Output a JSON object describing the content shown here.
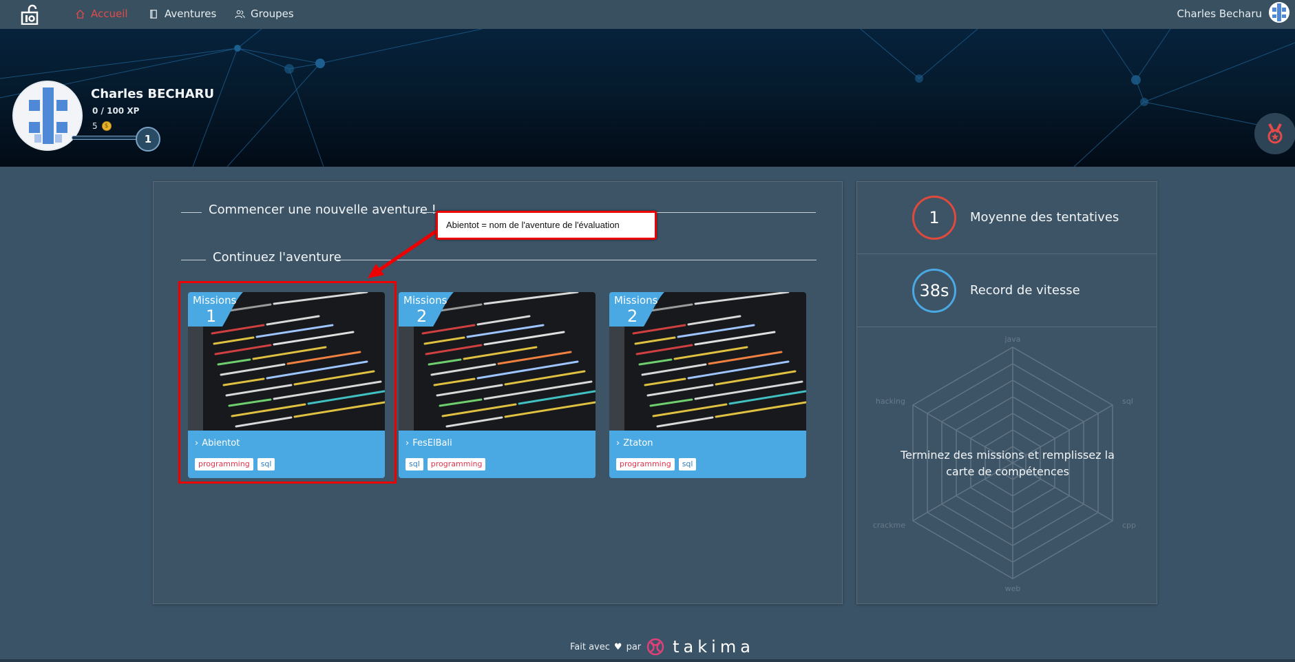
{
  "nav": {
    "logo": "lock-logo-icon",
    "items": [
      {
        "label": "Accueil",
        "icon": "home-icon",
        "active": true
      },
      {
        "label": "Aventures",
        "icon": "book-icon",
        "active": false
      },
      {
        "label": "Groupes",
        "icon": "users-icon",
        "active": false
      }
    ],
    "user_name": "Charles Becharu"
  },
  "profile": {
    "name": "Charles BECHARU",
    "xp": "0 / 100 XP",
    "coins": "5",
    "coin_symbol": "$",
    "level": "1",
    "xp_progress": 0
  },
  "main": {
    "new_adventure_title": "Commencer une nouvelle aventure !",
    "continue_title": "Continuez l'aventure",
    "cards": [
      {
        "missions_label": "Missions",
        "missions_count": "1",
        "title": "Abientot",
        "tags": [
          "programming",
          "sql"
        ]
      },
      {
        "missions_label": "Missions",
        "missions_count": "2",
        "title": "FesElBali",
        "tags": [
          "sql",
          "programming"
        ]
      },
      {
        "missions_label": "Missions",
        "missions_count": "2",
        "title": "Ztaton",
        "tags": [
          "programming",
          "sql"
        ]
      }
    ]
  },
  "annotation": {
    "callout_text": "Abientot = nom de l'aventure de l'évaluation",
    "color": "#ee0000"
  },
  "stats": {
    "attempts_value": "1",
    "attempts_label": "Moyenne des tentatives",
    "attempts_color": "#e04a3c",
    "speed_value": "38s",
    "speed_label": "Record de vitesse",
    "speed_color": "#4aa9e2",
    "radar_message": "Terminez des missions et remplissez la carte de compétences",
    "radar_axes": [
      "java",
      "sql",
      "cpp",
      "web",
      "crackme",
      "hacking"
    ]
  },
  "footer": {
    "made_with": "Fait avec",
    "by": "par",
    "brand": "takima",
    "heart_icon": "heart-icon"
  },
  "colors": {
    "accent_red": "#e34b4b",
    "card_blue": "#4aa9e2",
    "panel": "#3d5467",
    "background": "#3b5366"
  }
}
